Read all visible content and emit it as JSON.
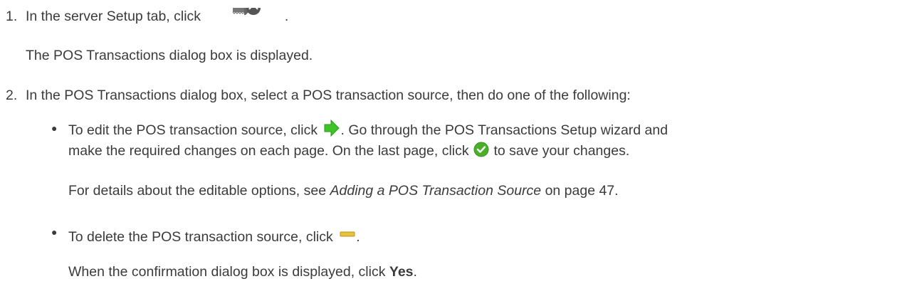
{
  "colors": {
    "text": "#3b3b3b",
    "green_arrow": "#3fc22a",
    "green_check": "#4caf2a",
    "delete_bar": "#e8c23a"
  },
  "steps": [
    {
      "number": "1.",
      "text_before": "In the server Setup tab, click",
      "icon": "pos-transactions-icon",
      "text_after": ".",
      "result": "The POS Transactions dialog box is displayed."
    },
    {
      "number": "2.",
      "text": "In the POS Transactions dialog box, select a POS transaction source, then do one of the following:",
      "bullets": [
        {
          "line1_before": "To edit the POS transaction source, click",
          "line1_icon": "green-arrow-icon",
          "line1_after": ". Go through the POS Transactions Setup wizard and",
          "line2_before": "make the required changes on each page. On the last page, click",
          "line2_icon": "green-check-icon",
          "line2_after": "to save your changes.",
          "note_before": "For details about the editable options, see",
          "note_link": "Adding a POS Transaction Source",
          "note_after": "on page 47."
        },
        {
          "line1_before": "To delete the POS transaction source, click",
          "line1_icon": "delete-minus-icon",
          "line1_after": ".",
          "note_before": "When the confirmation dialog box is displayed, click",
          "note_bold": "Yes",
          "note_after": "."
        }
      ]
    }
  ]
}
